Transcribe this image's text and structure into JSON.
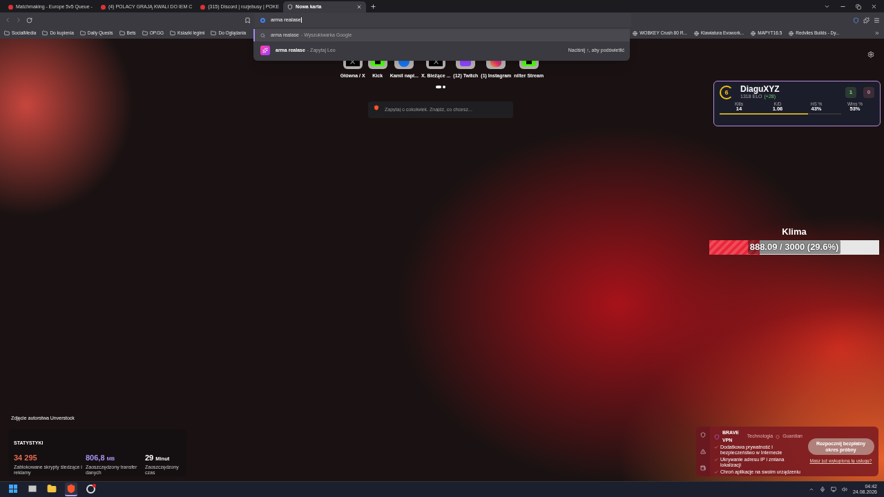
{
  "tabs": [
    {
      "title": "Matchmaking - Europe 5v5 Queue -",
      "selected": false
    },
    {
      "title": "(4) POLACY GRAJĄ KWALI DO IEM C",
      "selected": false
    },
    {
      "title": "(315) Discord | rozjebusy | POKE",
      "selected": false
    },
    {
      "title": "Nowa karta",
      "selected": true
    }
  ],
  "address": {
    "value": "arma realase"
  },
  "bookmarks_left": [
    "SocialMedia",
    "Do kupienia",
    "Daily Quests",
    "Bets",
    "OP.GG",
    "Ksiazki legimi",
    "Do Oglądania"
  ],
  "bookmarks_right": [
    "WOBKEY Crush 80 R...",
    "Klawiatura Evowork...",
    "MAPYT16.5",
    "Redviles Builds - Dy..."
  ],
  "suggestions": [
    {
      "kind": "search",
      "query": "arma realase",
      "source": "- Wyszukiwarka Google",
      "selected": true
    },
    {
      "kind": "leo",
      "query": "arma realase",
      "source": "- Zapytaj Leo",
      "hint": "Naciśnij ↑, aby podświetlić",
      "selected": false
    }
  ],
  "shortcuts": [
    {
      "kind": "x",
      "label": "Główna / X"
    },
    {
      "kind": "kick",
      "label": "Kick"
    },
    {
      "kind": "facebook",
      "label": "Kamil napi..."
    },
    {
      "kind": "x",
      "label": "X. Bieżące ..."
    },
    {
      "kind": "twitch",
      "label": "(12) Twitch"
    },
    {
      "kind": "instagram",
      "label": "(1) Instagram"
    },
    {
      "kind": "kick",
      "label": "nilter Stream"
    }
  ],
  "shortcut_pages": [
    {
      "selected": true
    },
    {
      "selected": false
    }
  ],
  "search_box": {
    "placeholder": "Zapytaj o cokolwiek. Znajdź, co chcesz..."
  },
  "faceit": {
    "rank": "6",
    "name": "DiaguXYZ",
    "elo": "1318 ELO",
    "elo_change": "(+28)",
    "wins": "1",
    "losses": "0",
    "stats": [
      {
        "label": "Kills",
        "value": "14"
      },
      {
        "label": "K/D",
        "value": "1.06"
      },
      {
        "label": "HS %",
        "value": "43%"
      },
      {
        "label": "Wins %",
        "value": "53%"
      }
    ],
    "progress": {
      "level": 0.73
    }
  },
  "klima": {
    "title": "Klima",
    "reading": "888.09 / 3000 (29.6%)",
    "level": 0.296
  },
  "photo_credit": "Zdjęcie autorstwa Unverstock",
  "stats": {
    "title": "STATYSTYKI",
    "items": [
      {
        "value": "34 295",
        "label": "Zablokowane skrypty śledzące i reklamy",
        "color": "#e8694f"
      },
      {
        "value": "806,8",
        "unit": "MB",
        "label": "Zaoszczędzony transfer danych",
        "color": "#a792f0"
      },
      {
        "value": "29",
        "unit": "Minut",
        "label": "Zaoszczędzony czas",
        "color": "#ffffff"
      }
    ]
  },
  "vpn": {
    "title": "BRAVE VPN",
    "tech": "Technologia",
    "partner": "Guardian",
    "features": [
      "Dodatkowa prywatność i bezpieczeństwo w Internecie",
      "Ukrywanie adresu IP i zmiana lokalizacji",
      "Chroń aplikacje na swoim urządzeniu"
    ],
    "button": "Rozpocznij bezpłatny okres próbny",
    "link": "Masz już wykupioną tę usługę?"
  },
  "taskbar": {
    "apps": [
      {
        "kind": "start",
        "selected": false
      },
      {
        "kind": "taskview",
        "selected": false
      },
      {
        "kind": "explorer",
        "selected": false
      },
      {
        "kind": "brave",
        "selected": true
      },
      {
        "kind": "obs",
        "selected": false
      }
    ],
    "time": "04:42",
    "date": "24.08.2026"
  }
}
